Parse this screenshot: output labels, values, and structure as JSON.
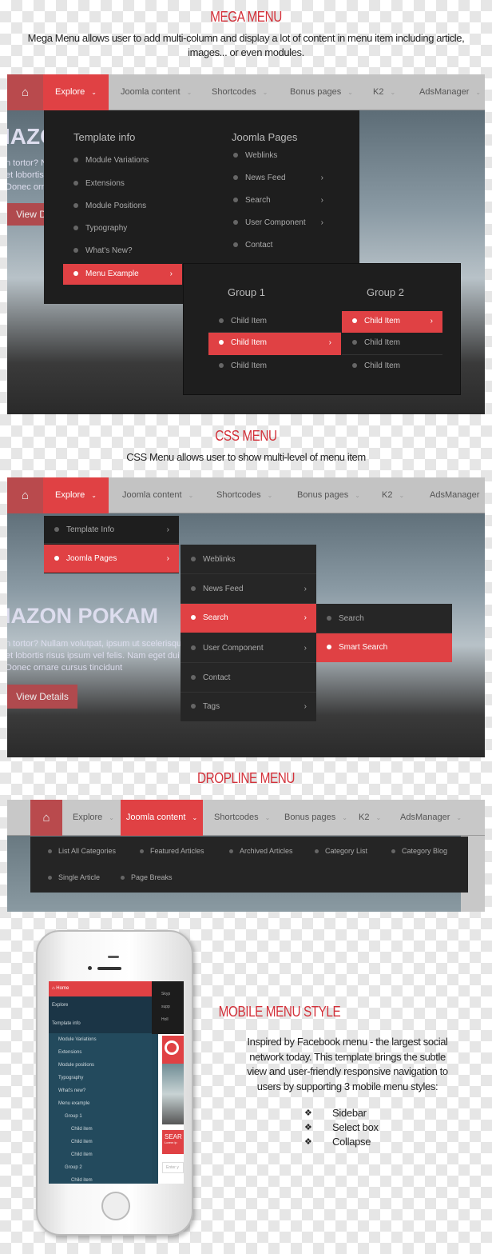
{
  "mega": {
    "title": "MEGA MENU",
    "desc1": "Mega Menu allows user to add multi-column and display a lot of content in menu item including article,",
    "desc2": "images... or  even modules.",
    "nav": [
      "Explore",
      "Joomla content",
      "Shortcodes",
      "Bonus pages",
      "K2",
      "AdsManager"
    ],
    "hero": {
      "heading": "IAZO",
      "lines": [
        "n tortor? Nu",
        "et lobortis r",
        "Donec orna"
      ],
      "button": "View D"
    },
    "col1": {
      "heading": "Template info",
      "items": [
        "Module Variations",
        "Extensions",
        "Module Positions",
        "Typography",
        "What's New?",
        "Menu Example"
      ]
    },
    "col2": {
      "heading": "Joomla Pages",
      "items": [
        "Weblinks",
        "News Feed",
        "Search",
        "User Component",
        "Contact"
      ]
    },
    "group1": {
      "heading": "Group 1",
      "items": [
        "Child Item",
        "Child Item",
        "Child Item"
      ]
    },
    "group2": {
      "heading": "Group 2",
      "items": [
        "Child Item",
        "Child Item",
        "Child Item"
      ]
    }
  },
  "css": {
    "title": "CSS MENU",
    "desc": "CSS Menu allows user to show multi-level of menu item",
    "nav": [
      "Explore",
      "Joomla content",
      "Shortcodes",
      "Bonus pages",
      "K2",
      "AdsManager"
    ],
    "hero": {
      "heading": "IAZON POKAM",
      "lines": [
        "n tortor? Nullam volutpat, ipsum ut scelerisque vu",
        "et lobortis risus ipsum vel felis. Nam eget dui vel",
        "Donec ornare cursus tincidunt"
      ],
      "button": "View Details"
    },
    "level1": [
      "Template Info",
      "Joomla Pages"
    ],
    "level2": [
      "Weblinks",
      "News Feed",
      "Search",
      "User Component",
      "Contact",
      "Tags"
    ],
    "level3": [
      "Search",
      "Smart Search"
    ]
  },
  "dropline": {
    "title": "DROPLINE MENU",
    "nav": [
      "Explore",
      "Joomla content",
      "Shortcodes",
      "Bonus pages",
      "K2",
      "AdsManager"
    ],
    "row1": [
      "List All Categories",
      "Featured Articles",
      "Archived Articles",
      "Category List",
      "Category Blog"
    ],
    "row2": [
      "Single Article",
      "Page Breaks"
    ]
  },
  "mobile": {
    "title": "MOBILE MENU STYLE",
    "para": [
      "Inspired by Facebook menu - the largest social",
      "network today. This template brings the subtle",
      "view and user-friendly responsive navigation to",
      "users by supporting 3 mobile menu styles:"
    ],
    "styles": [
      "Sidebar",
      "Select box",
      "Collapse"
    ],
    "phone": {
      "menu": [
        "Home",
        "Explore",
        "Template info",
        "Module Variations",
        "Extensions",
        "Module positions",
        "Typography",
        "What's new?",
        "Menu example",
        "Group 1",
        "Child item",
        "Child item",
        "Child item",
        "Group 2",
        "Child item"
      ],
      "side_text": [
        "Skyp",
        "supp",
        "Holl",
        "SEAR",
        "Lorem ip",
        "Enter y"
      ]
    }
  },
  "colors": {
    "accent": "#e04144",
    "title": "#d3313a",
    "panel": "#1e1e1e",
    "nav": "#c3c3c3"
  }
}
